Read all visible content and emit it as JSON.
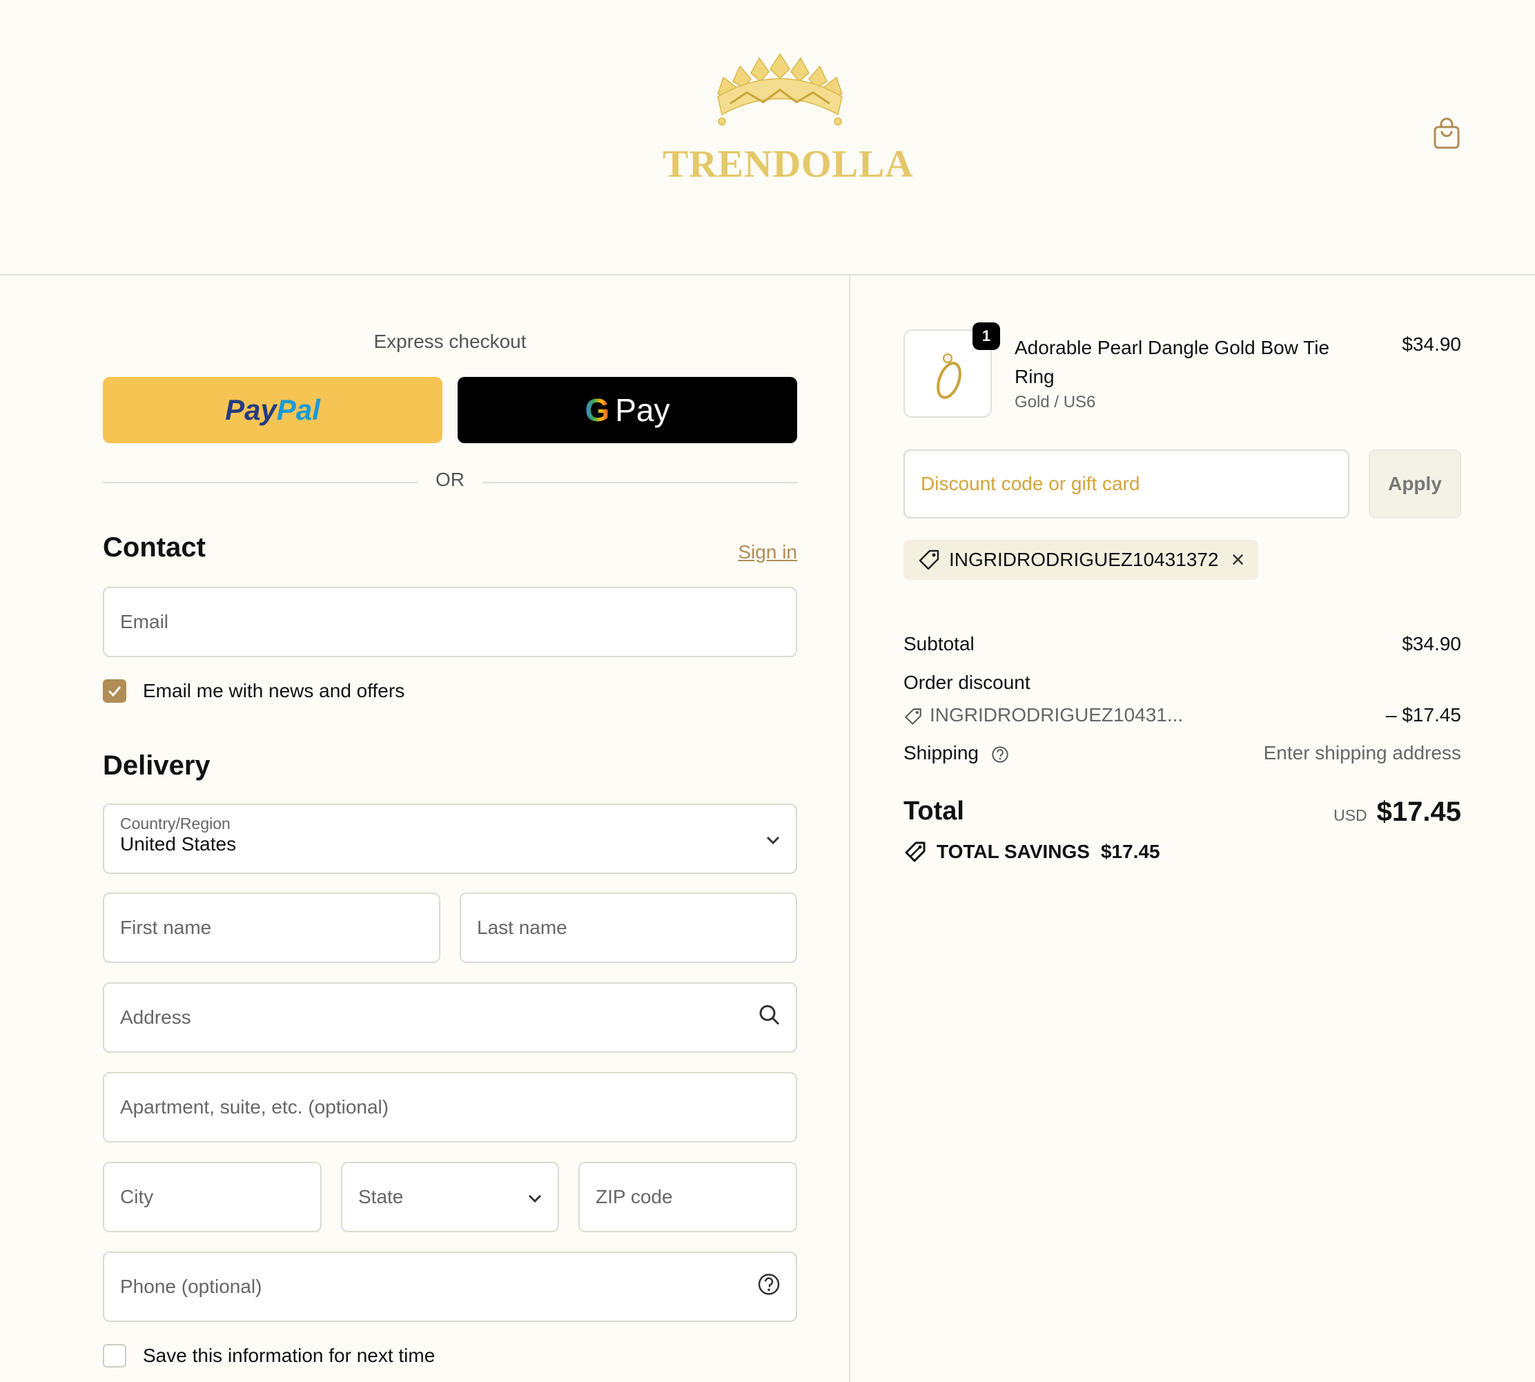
{
  "brand": {
    "name": "TRENDOLLA",
    "logo_icon": "crown-logo-icon",
    "color": "#e4c86a"
  },
  "header": {
    "cart_icon": "shopping-bag-icon"
  },
  "express": {
    "label": "Express checkout",
    "paypal_part1": "Pay",
    "paypal_part2": "Pal",
    "gpay_g": "G",
    "gpay_label": "Pay",
    "or_label": "OR"
  },
  "contact": {
    "heading": "Contact",
    "signin_link": "Sign in",
    "email_placeholder": "Email",
    "newsletter_label": "Email me with news and offers",
    "newsletter_checked": true
  },
  "delivery": {
    "heading": "Delivery",
    "country_label": "Country/Region",
    "country_value": "United States",
    "first_name_placeholder": "First name",
    "last_name_placeholder": "Last name",
    "address_placeholder": "Address",
    "apartment_placeholder": "Apartment, suite, etc. (optional)",
    "city_placeholder": "City",
    "state_placeholder": "State",
    "zip_placeholder": "ZIP code",
    "phone_placeholder": "Phone (optional)",
    "save_info_label": "Save this information for next time",
    "save_info_checked": false
  },
  "summary": {
    "item": {
      "quantity": "1",
      "name": "Adorable Pearl Dangle Gold Bow Tie Ring",
      "variant": "Gold / US6",
      "price": "$34.90"
    },
    "discount_placeholder": "Discount code or gift card",
    "apply_label": "Apply",
    "applied_code": "INGRIDRODRIGUEZ10431372",
    "subtotal_label": "Subtotal",
    "subtotal_value": "$34.90",
    "order_discount_label": "Order discount",
    "order_discount_code": "INGRIDRODRIGUEZ10431...",
    "order_discount_value": "– $17.45",
    "shipping_label": "Shipping",
    "shipping_value": "Enter shipping address",
    "total_label": "Total",
    "total_currency": "USD",
    "total_value": "$17.45",
    "savings_label": "TOTAL SAVINGS",
    "savings_value": "$17.45"
  },
  "colors": {
    "accent": "#b08d55",
    "paypal": "#f6c453",
    "background": "#fdfcf6"
  }
}
